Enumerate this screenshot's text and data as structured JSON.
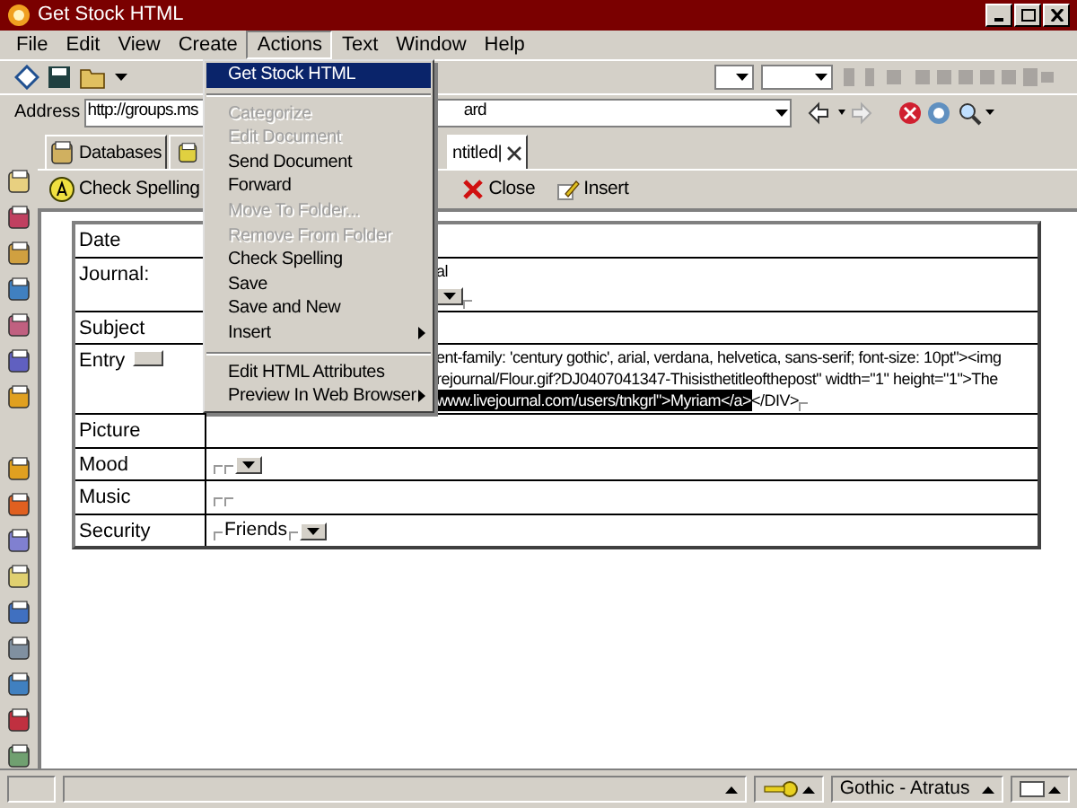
{
  "window": {
    "title": "Get Stock HTML"
  },
  "menu_bar": [
    {
      "label": "File",
      "selected": false
    },
    {
      "label": "Edit",
      "selected": false
    },
    {
      "label": "View",
      "selected": false
    },
    {
      "label": "Create",
      "selected": false
    },
    {
      "label": "Actions",
      "selected": true
    },
    {
      "label": "Text",
      "selected": false
    },
    {
      "label": "Window",
      "selected": false
    },
    {
      "label": "Help",
      "selected": false
    }
  ],
  "actions_menu": [
    {
      "kind": "item",
      "label": "Get Stock HTML",
      "selected": true,
      "disabled": false,
      "submenu": false
    },
    {
      "kind": "separator"
    },
    {
      "kind": "item",
      "label": "Categorize",
      "selected": false,
      "disabled": true,
      "submenu": false
    },
    {
      "kind": "item",
      "label": "Edit Document",
      "selected": false,
      "disabled": true,
      "submenu": false
    },
    {
      "kind": "item",
      "label": "Send Document",
      "selected": false,
      "disabled": false,
      "submenu": false
    },
    {
      "kind": "item",
      "label": "Forward",
      "selected": false,
      "disabled": false,
      "submenu": false
    },
    {
      "kind": "item",
      "label": "Move To Folder...",
      "selected": false,
      "disabled": true,
      "submenu": false
    },
    {
      "kind": "item",
      "label": "Remove From Folder",
      "selected": false,
      "disabled": true,
      "submenu": false
    },
    {
      "kind": "item",
      "label": "Check Spelling",
      "selected": false,
      "disabled": false,
      "submenu": false
    },
    {
      "kind": "item",
      "label": "Save",
      "selected": false,
      "disabled": false,
      "submenu": false
    },
    {
      "kind": "item",
      "label": "Save and New",
      "selected": false,
      "disabled": false,
      "submenu": false
    },
    {
      "kind": "item",
      "label": "Insert",
      "selected": false,
      "disabled": false,
      "submenu": true
    },
    {
      "kind": "separator"
    },
    {
      "kind": "item",
      "label": "Edit HTML Attributes",
      "selected": false,
      "disabled": false,
      "submenu": false
    },
    {
      "kind": "item",
      "label": "Preview In Web Browser",
      "selected": false,
      "disabled": false,
      "submenu": true
    }
  ],
  "address_bar": {
    "label": "Address",
    "value": "http://groups.ms",
    "value_end": "ard"
  },
  "tabs": [
    {
      "label": "Databases",
      "selected": false
    },
    {
      "label": "ntitled|",
      "selected": true
    }
  ],
  "action_bar": [
    {
      "label": "Check Spelling",
      "kind": "spell"
    },
    {
      "label": "Close",
      "kind": "close"
    },
    {
      "label": "Insert",
      "kind": "insert"
    }
  ],
  "form_rows": [
    {
      "label": "Date",
      "kind": "field",
      "label_button": false,
      "lines": []
    },
    {
      "label": "Journal:",
      "kind": "partial",
      "label_button": false,
      "lines": [
        [
          {
            "kind": "text",
            "text": "al",
            "selected": false
          }
        ],
        [
          {
            "kind": "dropdown"
          }
        ]
      ]
    },
    {
      "label": "Subject",
      "kind": "partial",
      "label_button": false,
      "lines": []
    },
    {
      "label": "Entry",
      "kind": "partial",
      "label_button": true,
      "lines": [
        [
          {
            "kind": "text",
            "text": "ent-family: 'century gothic', arial, verdana, helvetica, sans-serif; font-size: 10pt\"><img",
            "selected": false
          }
        ],
        [
          {
            "kind": "text",
            "text": "rejournal/Flour.gif?DJ0407041347-Thisisthetitleofthepost\" width=\"1\" height=\"1\">The",
            "selected": false
          }
        ],
        [
          {
            "kind": "text",
            "text": "www.livejournal.com/users/tnkgrl\">Myriam</a>",
            "selected": true
          },
          {
            "kind": "text",
            "text": "</DIV>",
            "selected": false
          }
        ]
      ]
    },
    {
      "label": "Picture",
      "kind": "partial",
      "label_button": false,
      "lines": []
    },
    {
      "label": "Mood",
      "kind": "field",
      "label_button": false,
      "lines": [
        [
          {
            "kind": "dropdown"
          }
        ]
      ]
    },
    {
      "label": "Music",
      "kind": "field",
      "label_button": false,
      "lines": []
    },
    {
      "label": "Security",
      "kind": "field",
      "label_button": false,
      "lines": [
        [
          {
            "kind": "text",
            "text": "Friends",
            "selected": false
          },
          {
            "kind": "dropdown"
          }
        ]
      ]
    }
  ],
  "status_bar": {
    "font": "Gothic - Atratus"
  }
}
